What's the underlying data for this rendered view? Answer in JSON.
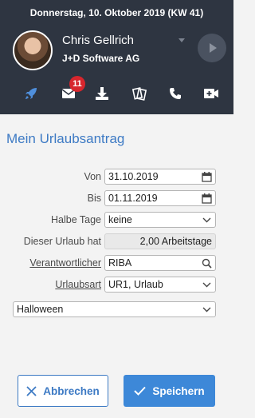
{
  "header": {
    "date_line": "Donnerstag, 10. Oktober 2019 (KW 41)",
    "user_name": "Chris Gellrich",
    "company": "J+D Software AG"
  },
  "icons": {
    "rocket": "rocket-icon",
    "mail": "mail-icon",
    "download": "download-icon",
    "documents": "documents-icon",
    "phone": "phone-icon",
    "video": "video-icon",
    "play": "play-icon"
  },
  "mail_badge": "11",
  "form": {
    "title": "Mein Urlaubsantrag",
    "von_label": "Von",
    "von_value": "31.10.2019",
    "bis_label": "Bis",
    "bis_value": "01.11.2019",
    "halbe_tage_label": "Halbe Tage",
    "halbe_tage_value": "keine",
    "dieser_urlaub_label": "Dieser Urlaub hat",
    "dieser_urlaub_value": "2,00 Arbeitstage",
    "verantwortlicher_label": "Verantwortlicher",
    "verantwortlicher_value": "RIBA",
    "urlaubsart_label": "Urlaubsart",
    "urlaubsart_value": "UR1, Urlaub",
    "anlass_value": "Halloween"
  },
  "buttons": {
    "cancel": "Abbrechen",
    "save": "Speichern"
  },
  "colors": {
    "header_bg": "#2e3541",
    "accent_blue": "#3d7ac4",
    "save_bg": "#3d88d8",
    "badge_red": "#d7262d"
  }
}
